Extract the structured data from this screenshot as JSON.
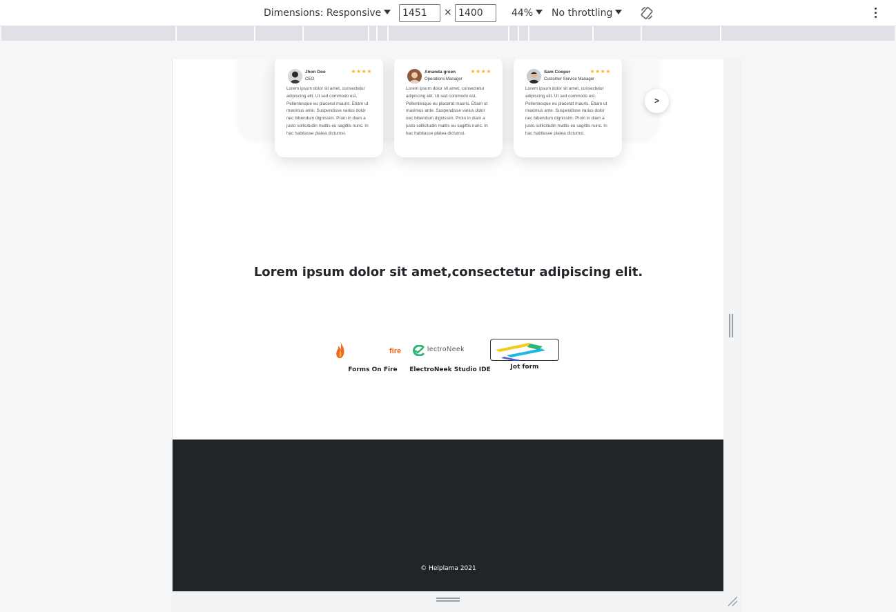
{
  "toolbar": {
    "dimensions_label": "Dimensions: Responsive",
    "width_value": "1451",
    "times": "×",
    "height_value": "1400",
    "zoom_label": "44%",
    "throttling_label": "No throttling",
    "rotate_icon": "rotate-icon",
    "more_icon": "kebab-menu-icon"
  },
  "testimonials": [
    {
      "name": "Jhon Doe",
      "role": "CEO",
      "stars": "★★★★",
      "quote": "Lorem ipsum dolor sit amet, consectetur adipiscing elit. Ut sed commodo est. Pellentesque eu placerat mauris. Etiam ut maximus ante. Suspendisse varius dolor nec bibendum dignissim. Proin in diam a justo sollicitudin mattis eu sagittis nunc. In hac habitasse platea dictumst."
    },
    {
      "name": "Amanda green",
      "role": "Operations Manager",
      "stars": "★★★★",
      "quote": "Lorem ipsum dolor sit amet, consectetur adipiscing elit. Ut sed commodo est. Pellentesque eu placerat mauris. Etiam ut maximus ante. Suspendisse varius dolor nec bibendum dignissim. Proin in diam a justo sollicitudin mattis eu sagittis nunc. In hac habitasse platea dictumst."
    },
    {
      "name": "Sam Cooper",
      "role": "Customer Service Manager",
      "stars": "★★★★",
      "quote": "Lorem ipsum dolor sit amet, consectetur adipiscing elit. Ut sed commodo est. Pellentesque eu placerat mauris. Etiam ut maximus ante. Suspendisse varius dolor nec bibendum dignissim. Proin in diam a justo sollicitudin mattis eu sagittis nunc. In hac habitasse platea dictumst."
    }
  ],
  "next_label": ">",
  "headline": "Lorem ipsum dolor sit amet,consectetur adipiscing elit.",
  "brands": [
    {
      "label": "Forms On Fire",
      "logo_text": "fire"
    },
    {
      "label": "ElectroNeek Studio IDE",
      "logo_text": "lectroNeek"
    },
    {
      "label": "Jot form"
    }
  ],
  "footer": {
    "copyright": "© Helplama 2021"
  },
  "colors": {
    "star": "#f7b52c",
    "footer_bg": "#212529",
    "fire_orange": "#f26522",
    "electroneek_green": "#2bb673"
  }
}
